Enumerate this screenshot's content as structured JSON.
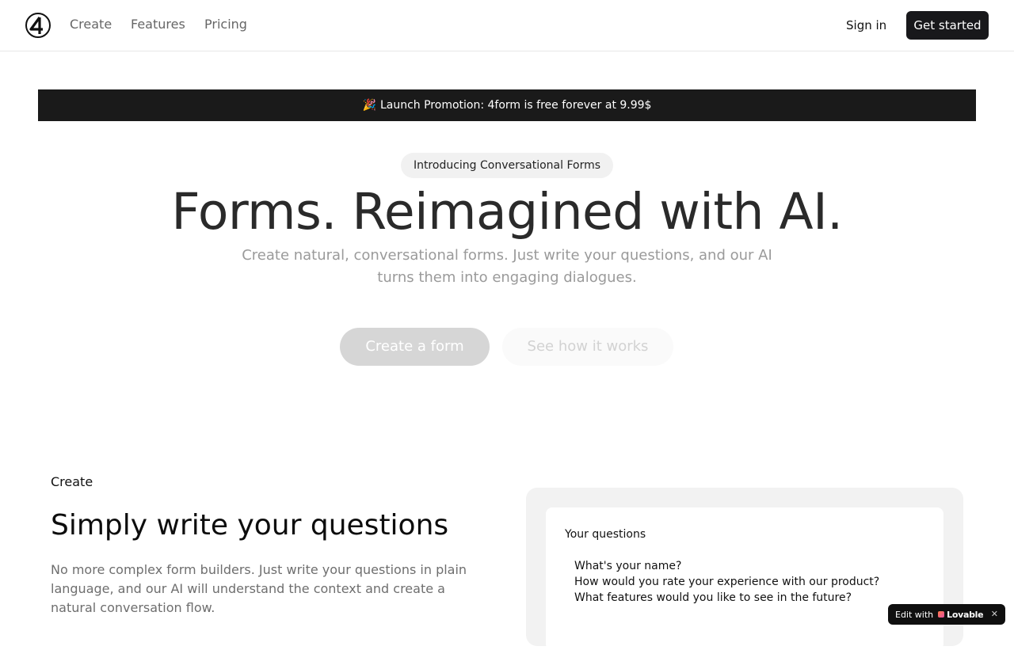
{
  "nav": {
    "logo_icon": "4form-logo-icon",
    "links": [
      "Create",
      "Features",
      "Pricing"
    ],
    "signin_label": "Sign in",
    "get_started_label": "Get started"
  },
  "promo": {
    "icon": "party-popper-icon",
    "emoji": "🎉",
    "text": "Launch Promotion: 4form is free forever at 9.99$"
  },
  "hero": {
    "badge": "Introducing Conversational Forms",
    "title": "Forms. Reimagined with AI.",
    "subtitle": "Create natural, conversational forms. Just write your questions, and our AI turns them into engaging dialogues.",
    "primary_cta": "Create a form",
    "secondary_cta": "See how it works"
  },
  "section": {
    "eyebrow": "Create",
    "title": "Simply write your questions",
    "description": "No more complex form builders. Just write your questions in plain language, and our AI will understand the context and create a natural conversation flow.",
    "panel_label": "Your questions",
    "questions": [
      "What's your name?",
      "How would you rate your experience with our product?",
      "What features would you like to see in the future?"
    ]
  },
  "badge": {
    "prefix": "Edit with",
    "brand": "Lovable",
    "close_icon": "close-icon"
  },
  "colors": {
    "promo_bg": "#1a1a1a",
    "primary_button": "#18181b",
    "muted_text": "#9a9a9a"
  }
}
